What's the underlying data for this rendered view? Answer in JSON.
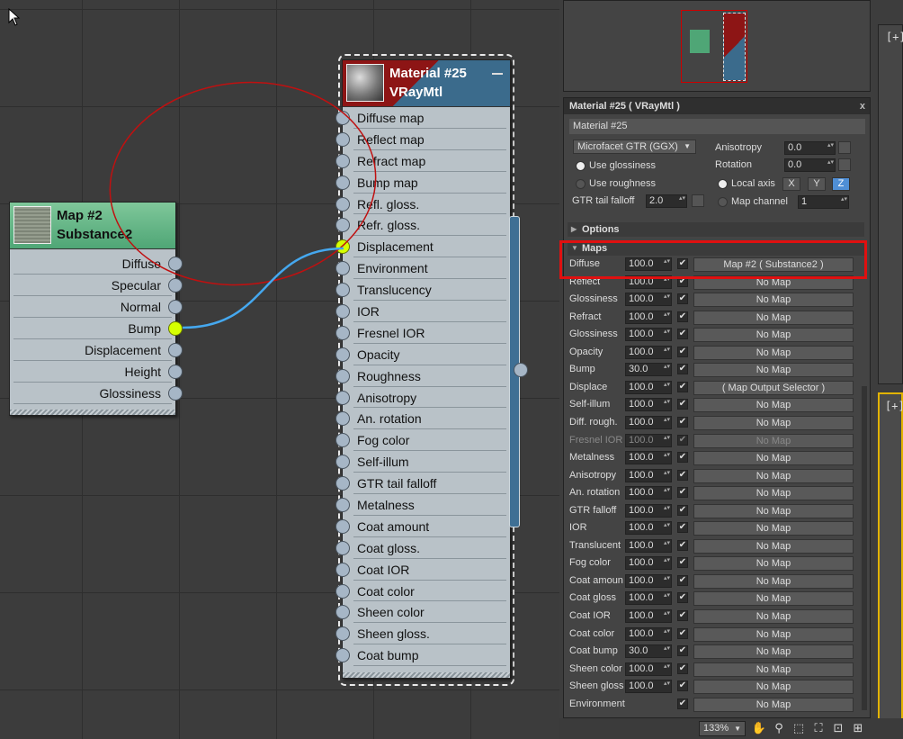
{
  "map_node": {
    "title_line1": "Map #2",
    "title_line2": "Substance2",
    "outputs": [
      "Diffuse",
      "Specular",
      "Normal",
      "Bump",
      "Displacement",
      "Height",
      "Glossiness"
    ]
  },
  "material_node": {
    "title_line1": "Material #25",
    "title_line2": "VRayMtl",
    "inputs": [
      "Diffuse map",
      "Reflect map",
      "Refract map",
      "Bump map",
      "Refl. gloss.",
      "Refr. gloss.",
      "Displacement",
      "Environment",
      "Translucency",
      "IOR",
      "Fresnel IOR",
      "Opacity",
      "Roughness",
      "Anisotropy",
      "An. rotation",
      "Fog color",
      "Self-illum",
      "GTR tail falloff",
      "Metalness",
      "Coat amount",
      "Coat gloss.",
      "Coat IOR",
      "Coat color",
      "Sheen color",
      "Sheen gloss.",
      "Coat bump"
    ]
  },
  "colors": {
    "accent": "#4f8fd6",
    "highlight": "#e01010",
    "wire": "#45a8ef",
    "active_socket": "#d6ff00"
  },
  "viewports": {
    "top_label": "[+]",
    "bottom_label": "[+]"
  },
  "prop": {
    "title": "Material #25  ( VRayMtl )",
    "close": "x",
    "name": "Material #25",
    "brdf": "Microfacet GTR (GGX)",
    "use_glossiness": "Use glossiness",
    "use_roughness": "Use roughness",
    "gtr_label": "GTR tail falloff",
    "gtr_value": "2.0",
    "anisotropy_label": "Anisotropy",
    "anisotropy_value": "0.0",
    "rotation_label": "Rotation",
    "rotation_value": "0.0",
    "local_axis": "Local axis",
    "axis_x": "X",
    "axis_y": "Y",
    "axis_z": "Z",
    "map_channel_label": "Map channel",
    "map_channel_value": "1",
    "options_label": "Options",
    "maps_label": "Maps"
  },
  "maps": [
    {
      "label": "Diffuse",
      "value": "100.0",
      "checked": "✔",
      "map": "Map #2  ( Substance2 )",
      "dim": false
    },
    {
      "label": "Reflect",
      "value": "100.0",
      "checked": "✔",
      "map": "No Map",
      "dim": false
    },
    {
      "label": "Glossiness",
      "value": "100.0",
      "checked": "✔",
      "map": "No Map",
      "dim": false
    },
    {
      "label": "Refract",
      "value": "100.0",
      "checked": "✔",
      "map": "No Map",
      "dim": false
    },
    {
      "label": "Glossiness",
      "value": "100.0",
      "checked": "✔",
      "map": "No Map",
      "dim": false
    },
    {
      "label": "Opacity",
      "value": "100.0",
      "checked": "✔",
      "map": "No Map",
      "dim": false
    },
    {
      "label": "Bump",
      "value": "30.0",
      "checked": "✔",
      "map": "No Map",
      "dim": false
    },
    {
      "label": "Displace",
      "value": "100.0",
      "checked": "✔",
      "map": "( Map Output Selector )",
      "dim": false
    },
    {
      "label": "Self-illum",
      "value": "100.0",
      "checked": "✔",
      "map": "No Map",
      "dim": false
    },
    {
      "label": "Diff. rough.",
      "value": "100.0",
      "checked": "✔",
      "map": "No Map",
      "dim": false
    },
    {
      "label": "Fresnel IOR",
      "value": "100.0",
      "checked": "✔",
      "map": "No Map",
      "dim": true
    },
    {
      "label": "Metalness",
      "value": "100.0",
      "checked": "✔",
      "map": "No Map",
      "dim": false
    },
    {
      "label": "Anisotropy",
      "value": "100.0",
      "checked": "✔",
      "map": "No Map",
      "dim": false
    },
    {
      "label": "An. rotation",
      "value": "100.0",
      "checked": "✔",
      "map": "No Map",
      "dim": false
    },
    {
      "label": "GTR falloff",
      "value": "100.0",
      "checked": "✔",
      "map": "No Map",
      "dim": false
    },
    {
      "label": "IOR",
      "value": "100.0",
      "checked": "✔",
      "map": "No Map",
      "dim": false
    },
    {
      "label": "Translucent",
      "value": "100.0",
      "checked": "✔",
      "map": "No Map",
      "dim": false
    },
    {
      "label": "Fog color",
      "value": "100.0",
      "checked": "✔",
      "map": "No Map",
      "dim": false
    },
    {
      "label": "Coat amoun",
      "value": "100.0",
      "checked": "✔",
      "map": "No Map",
      "dim": false
    },
    {
      "label": "Coat gloss",
      "value": "100.0",
      "checked": "✔",
      "map": "No Map",
      "dim": false
    },
    {
      "label": "Coat IOR",
      "value": "100.0",
      "checked": "✔",
      "map": "No Map",
      "dim": false
    },
    {
      "label": "Coat color",
      "value": "100.0",
      "checked": "✔",
      "map": "No Map",
      "dim": false
    },
    {
      "label": "Coat bump",
      "value": "30.0",
      "checked": "✔",
      "map": "No Map",
      "dim": false
    },
    {
      "label": "Sheen color",
      "value": "100.0",
      "checked": "✔",
      "map": "No Map",
      "dim": false
    },
    {
      "label": "Sheen gloss",
      "value": "100.0",
      "checked": "✔",
      "map": "No Map",
      "dim": false
    },
    {
      "label": "Environment",
      "value": "",
      "checked": "✔",
      "map": "No Map",
      "dim": false
    }
  ],
  "bottombar": {
    "zoom": "133%",
    "tools": [
      "hand-icon",
      "zoom-icon",
      "zoom-region-icon",
      "zoom-extents-icon",
      "zoom-selected-icon",
      "pan-to-selected-icon"
    ]
  }
}
